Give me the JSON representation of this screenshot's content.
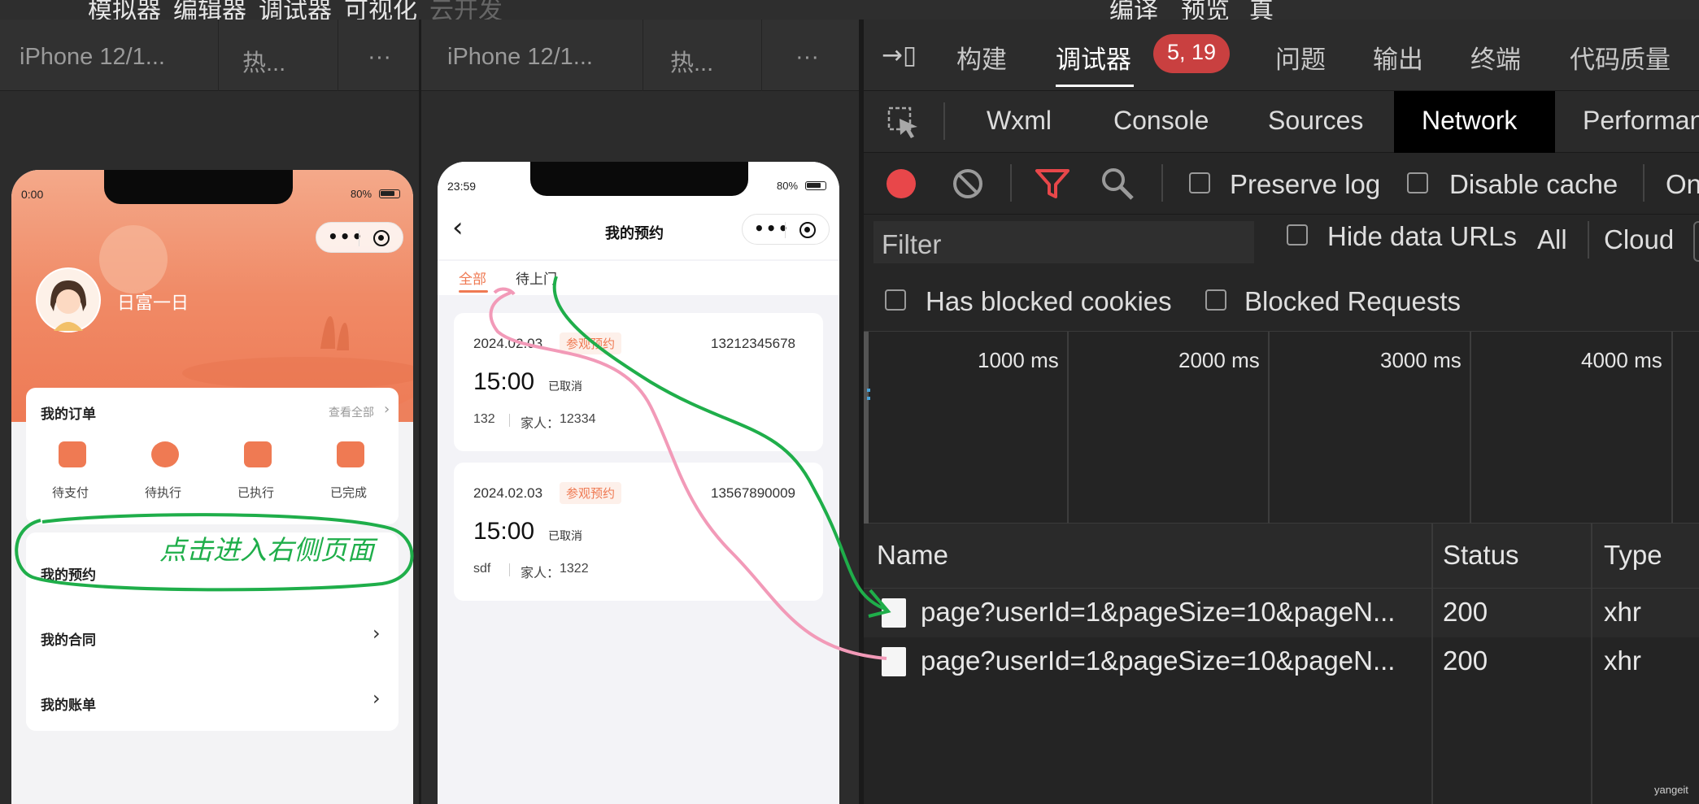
{
  "top_menu": [
    "模拟器",
    "编辑器",
    "调试器",
    "可视化",
    "云开发",
    "编译",
    "预览",
    "真"
  ],
  "sim_left": {
    "tabs": [
      "iPhone 12/1...",
      "热...",
      "···"
    ],
    "status": {
      "time": "0:00",
      "battery": "80%"
    },
    "user": {
      "name": "日富一日"
    },
    "orders": {
      "title": "我的订单",
      "view_all": "查看全部",
      "items": [
        "待支付",
        "待执行",
        "已执行",
        "已完成"
      ]
    },
    "menu": {
      "reservation": "我的预约",
      "contract": "我的合同",
      "bill": "我的账单"
    },
    "annotation": "点击进入右侧页面"
  },
  "sim_right": {
    "tabs": [
      "iPhone 12/1...",
      "热...",
      "···"
    ],
    "status": {
      "time": "23:59",
      "battery": "80%"
    },
    "page_title": "我的预约",
    "filter_tabs": [
      "全部",
      "待上门"
    ],
    "cards": [
      {
        "date": "2024.02.03",
        "tag": "参观预约",
        "phone": "13212345678",
        "time": "15:00",
        "state": "已取消",
        "name": "132",
        "family_label": "家人：",
        "family": "12334"
      },
      {
        "date": "2024.02.03",
        "tag": "参观预约",
        "phone": "13567890009",
        "time": "15:00",
        "state": "已取消",
        "name": "sdf",
        "family_label": "家人：",
        "family": "1322"
      }
    ]
  },
  "devtools": {
    "top_tabs": [
      "构建",
      "调试器",
      "问题",
      "输出",
      "终端",
      "代码质量"
    ],
    "badge": "5, 19",
    "panel_tabs": [
      "Wxml",
      "Console",
      "Sources",
      "Network",
      "Performan"
    ],
    "toolbar": {
      "preserve_log": "Preserve log",
      "disable_cache": "Disable cache",
      "online": "On"
    },
    "filter": {
      "placeholder": "Filter",
      "hide_data_urls": "Hide data URLs",
      "all": "All",
      "cloud": "Cloud"
    },
    "filter2": {
      "blocked_cookies": "Has blocked cookies",
      "blocked_requests": "Blocked Requests"
    },
    "timeline": [
      "1000 ms",
      "2000 ms",
      "3000 ms",
      "4000 ms"
    ],
    "columns": {
      "name": "Name",
      "status": "Status",
      "type": "Type"
    },
    "requests": [
      {
        "name": "page?userId=1&pageSize=10&pageN...",
        "status": "200",
        "type": "xhr"
      },
      {
        "name": "page?userId=1&pageSize=10&pageN...",
        "status": "200",
        "type": "xhr"
      }
    ],
    "watermark": "yangeit"
  },
  "colors": {
    "accent": "#ef7a53",
    "record": "#e8474a",
    "badge": "#c94040",
    "green_annotation": "#1fae4a",
    "pink_annotation": "#f29ab8"
  }
}
